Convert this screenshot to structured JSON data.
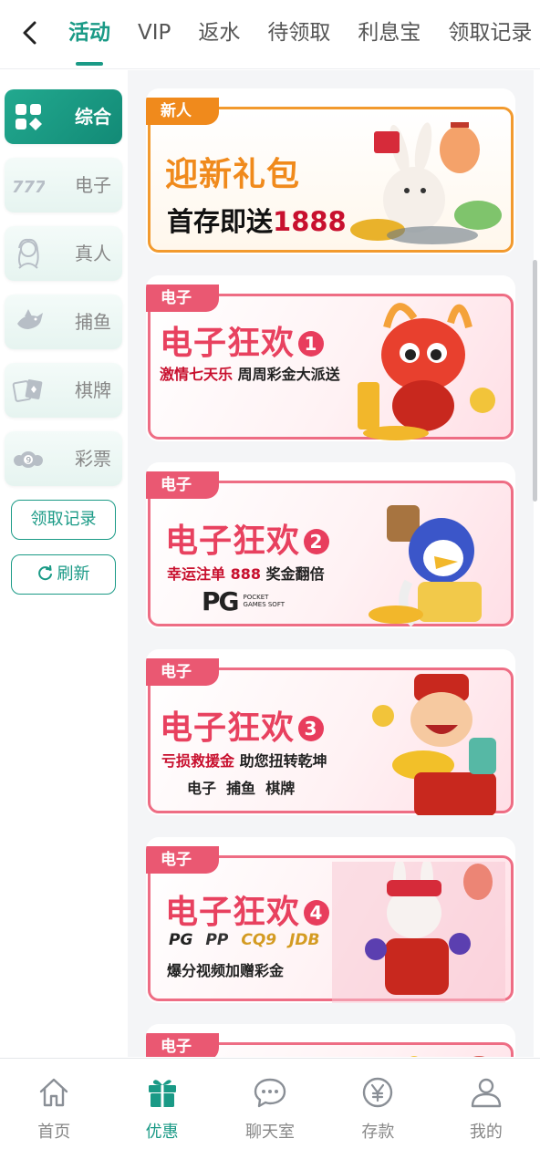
{
  "header": {
    "tabs": [
      {
        "label": "活动",
        "active": true
      },
      {
        "label": "VIP"
      },
      {
        "label": "返水"
      },
      {
        "label": "待领取"
      },
      {
        "label": "利息宝"
      },
      {
        "label": "领取记录"
      }
    ]
  },
  "sidebar": {
    "categories": [
      {
        "label": "综合",
        "icon": "grid-icon",
        "active": true
      },
      {
        "label": "电子",
        "icon": "slots-777-icon"
      },
      {
        "label": "真人",
        "icon": "live-dealer-icon"
      },
      {
        "label": "捕鱼",
        "icon": "fish-icon"
      },
      {
        "label": "棋牌",
        "icon": "cards-icon"
      },
      {
        "label": "彩票",
        "icon": "lottery-ball-icon"
      }
    ],
    "record_button": "领取记录",
    "refresh_button": "刷新"
  },
  "promos": [
    {
      "tag": "新人",
      "title": "迎新礼包",
      "subtitle_prefix": "首存即送",
      "subtitle_amount": "1888"
    },
    {
      "tag": "电子",
      "title": "电子狂欢",
      "number": "1",
      "sub_red": "激情七天乐",
      "sub_rest": "周周彩金大派送"
    },
    {
      "tag": "电子",
      "title": "电子狂欢",
      "number": "2",
      "sub_red": "幸运注单 888",
      "sub_rest": "奖金翻倍",
      "brand": "PG",
      "brand_small": "POCKET GAMES SOFT"
    },
    {
      "tag": "电子",
      "title": "电子狂欢",
      "number": "3",
      "sub_red": "亏损救援金",
      "sub_rest": "助您扭转乾坤",
      "games": "电子  捕鱼  棋牌"
    },
    {
      "tag": "电子",
      "title": "电子狂欢",
      "number": "4",
      "brands": [
        "PG",
        "PP",
        "CQ9",
        "JDB"
      ],
      "sub_rest": "爆分视频加赠彩金"
    },
    {
      "tag": "电子"
    }
  ],
  "bottom_nav": [
    {
      "label": "首页",
      "icon": "home-icon"
    },
    {
      "label": "优惠",
      "icon": "gift-icon",
      "active": true
    },
    {
      "label": "聊天室",
      "icon": "chat-icon"
    },
    {
      "label": "存款",
      "icon": "yen-coin-icon"
    },
    {
      "label": "我的",
      "icon": "user-icon"
    }
  ],
  "colors": {
    "accent": "#1a9a86",
    "promo_pink": "#ea5872",
    "promo_orange": "#f08a1c"
  }
}
